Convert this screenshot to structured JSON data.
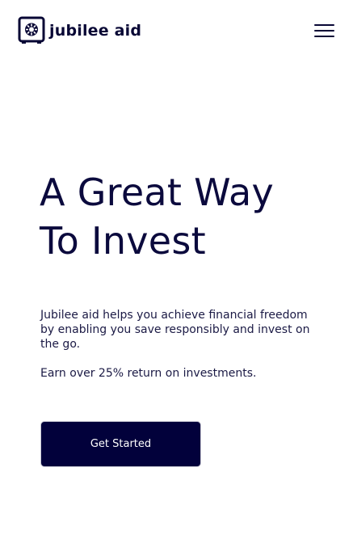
{
  "header": {
    "brand_name": "jubilee aid",
    "logo_icon": "safe-icon",
    "menu_icon": "hamburger-menu-icon"
  },
  "hero": {
    "title_line1": "A Great Way",
    "title_line2": "To Invest",
    "description": "Jubilee aid helps you achieve financial freedom by enabling you save responsibly and invest on the go.",
    "return_text": "Earn over 25% return on investments.",
    "cta_label": "Get Started"
  },
  "colors": {
    "brand_navy": "#02013b",
    "text_dark": "#0b0a3d",
    "background": "#ffffff"
  }
}
